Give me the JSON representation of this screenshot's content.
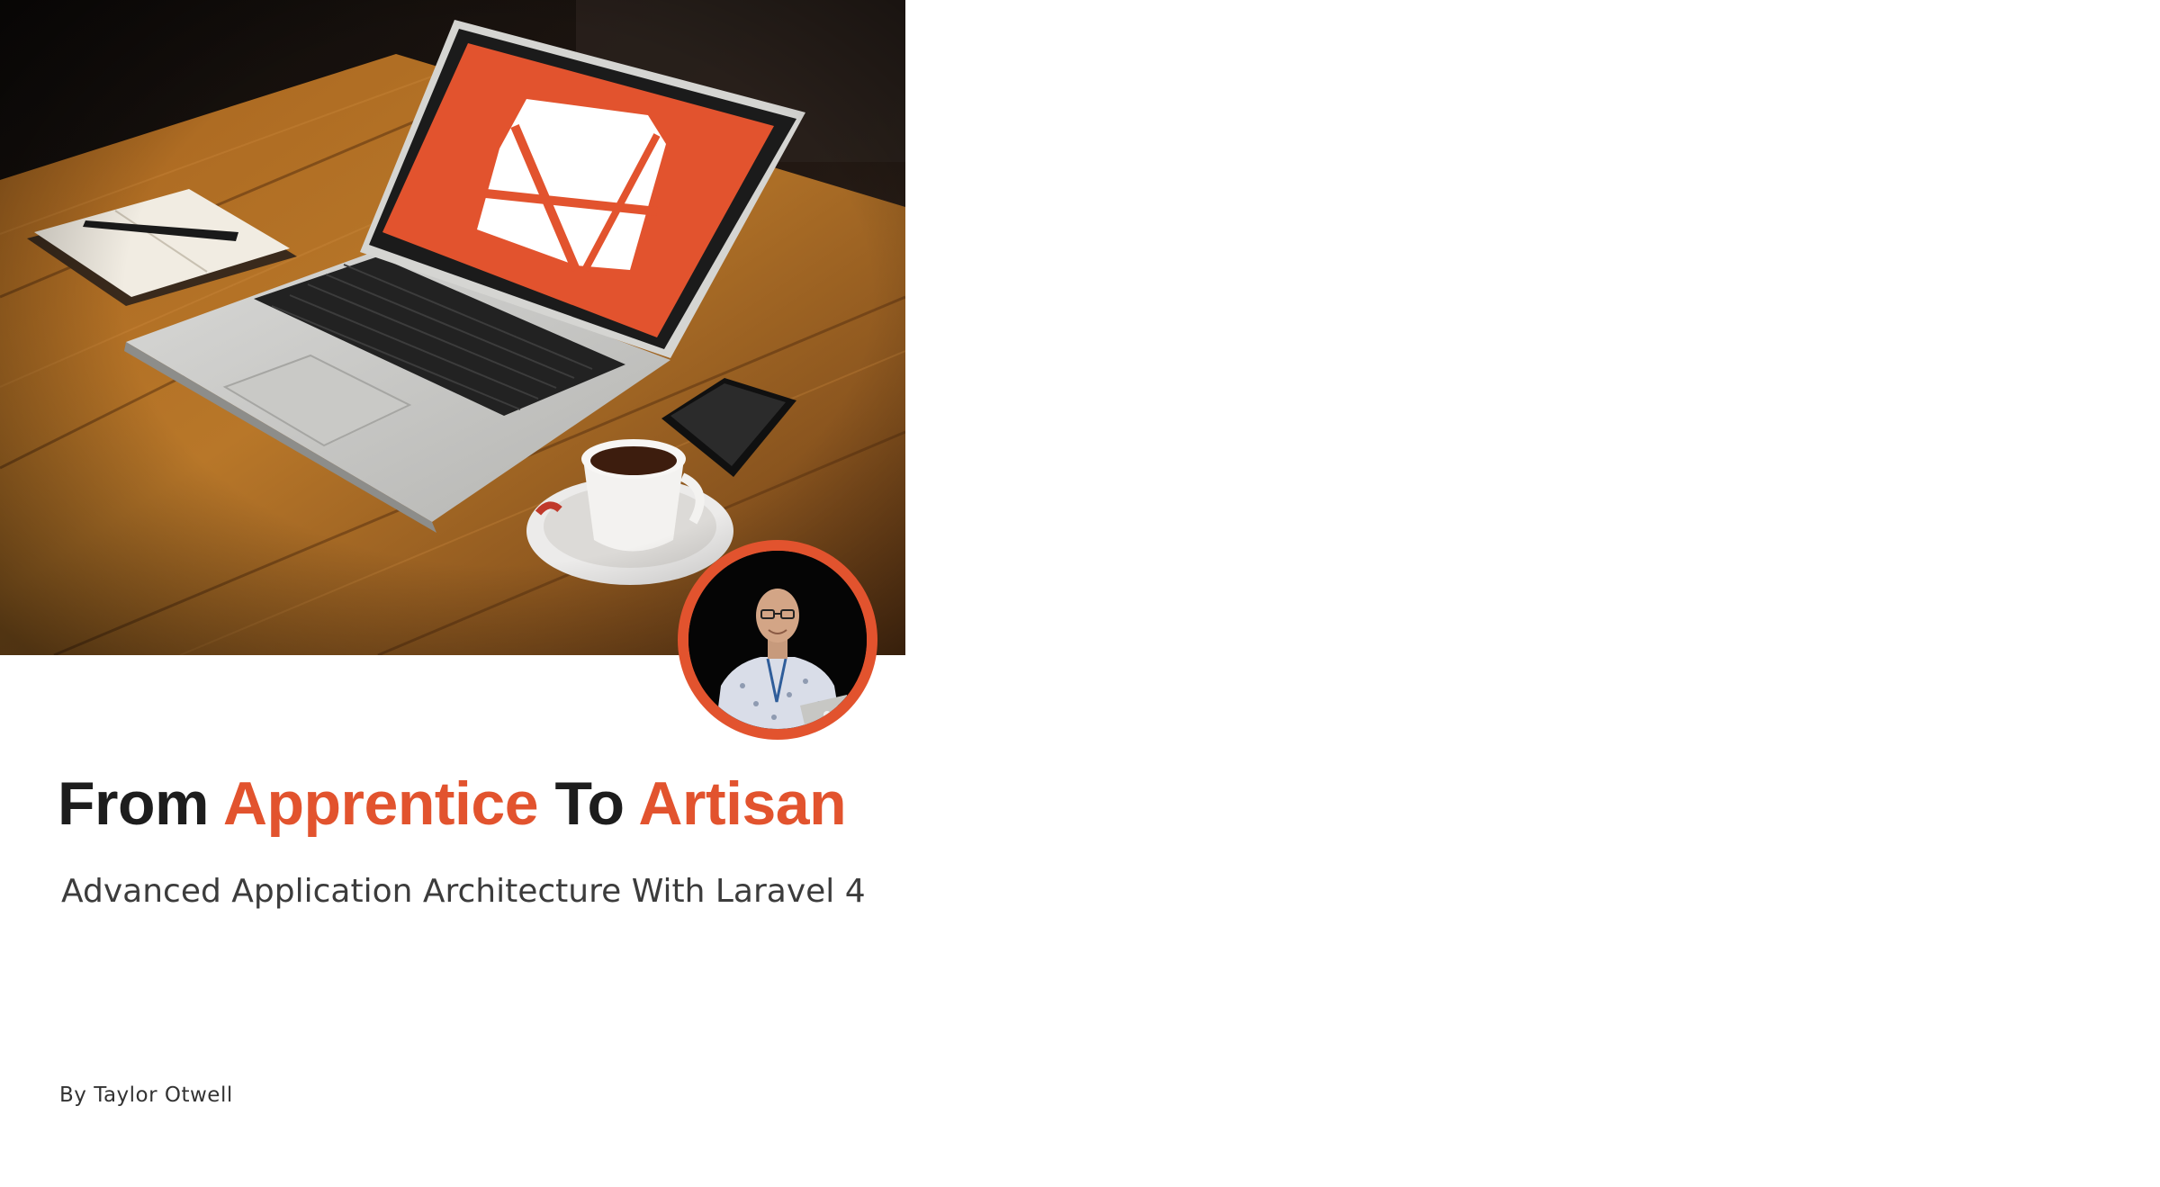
{
  "cover": {
    "title": {
      "word1": "From",
      "word2": "Apprentice",
      "word3": "To",
      "word4": "Artisan"
    },
    "subtitle": "Advanced Application Architecture With Laravel 4",
    "byline": "By Taylor Otwell"
  },
  "colors": {
    "accent": "#e2532e",
    "title_dark": "#1d1d1d",
    "subtitle": "#3c3c3c"
  },
  "icons": {
    "laptop_screen": "laravel-logo-icon",
    "author_photo": "author-avatar"
  }
}
